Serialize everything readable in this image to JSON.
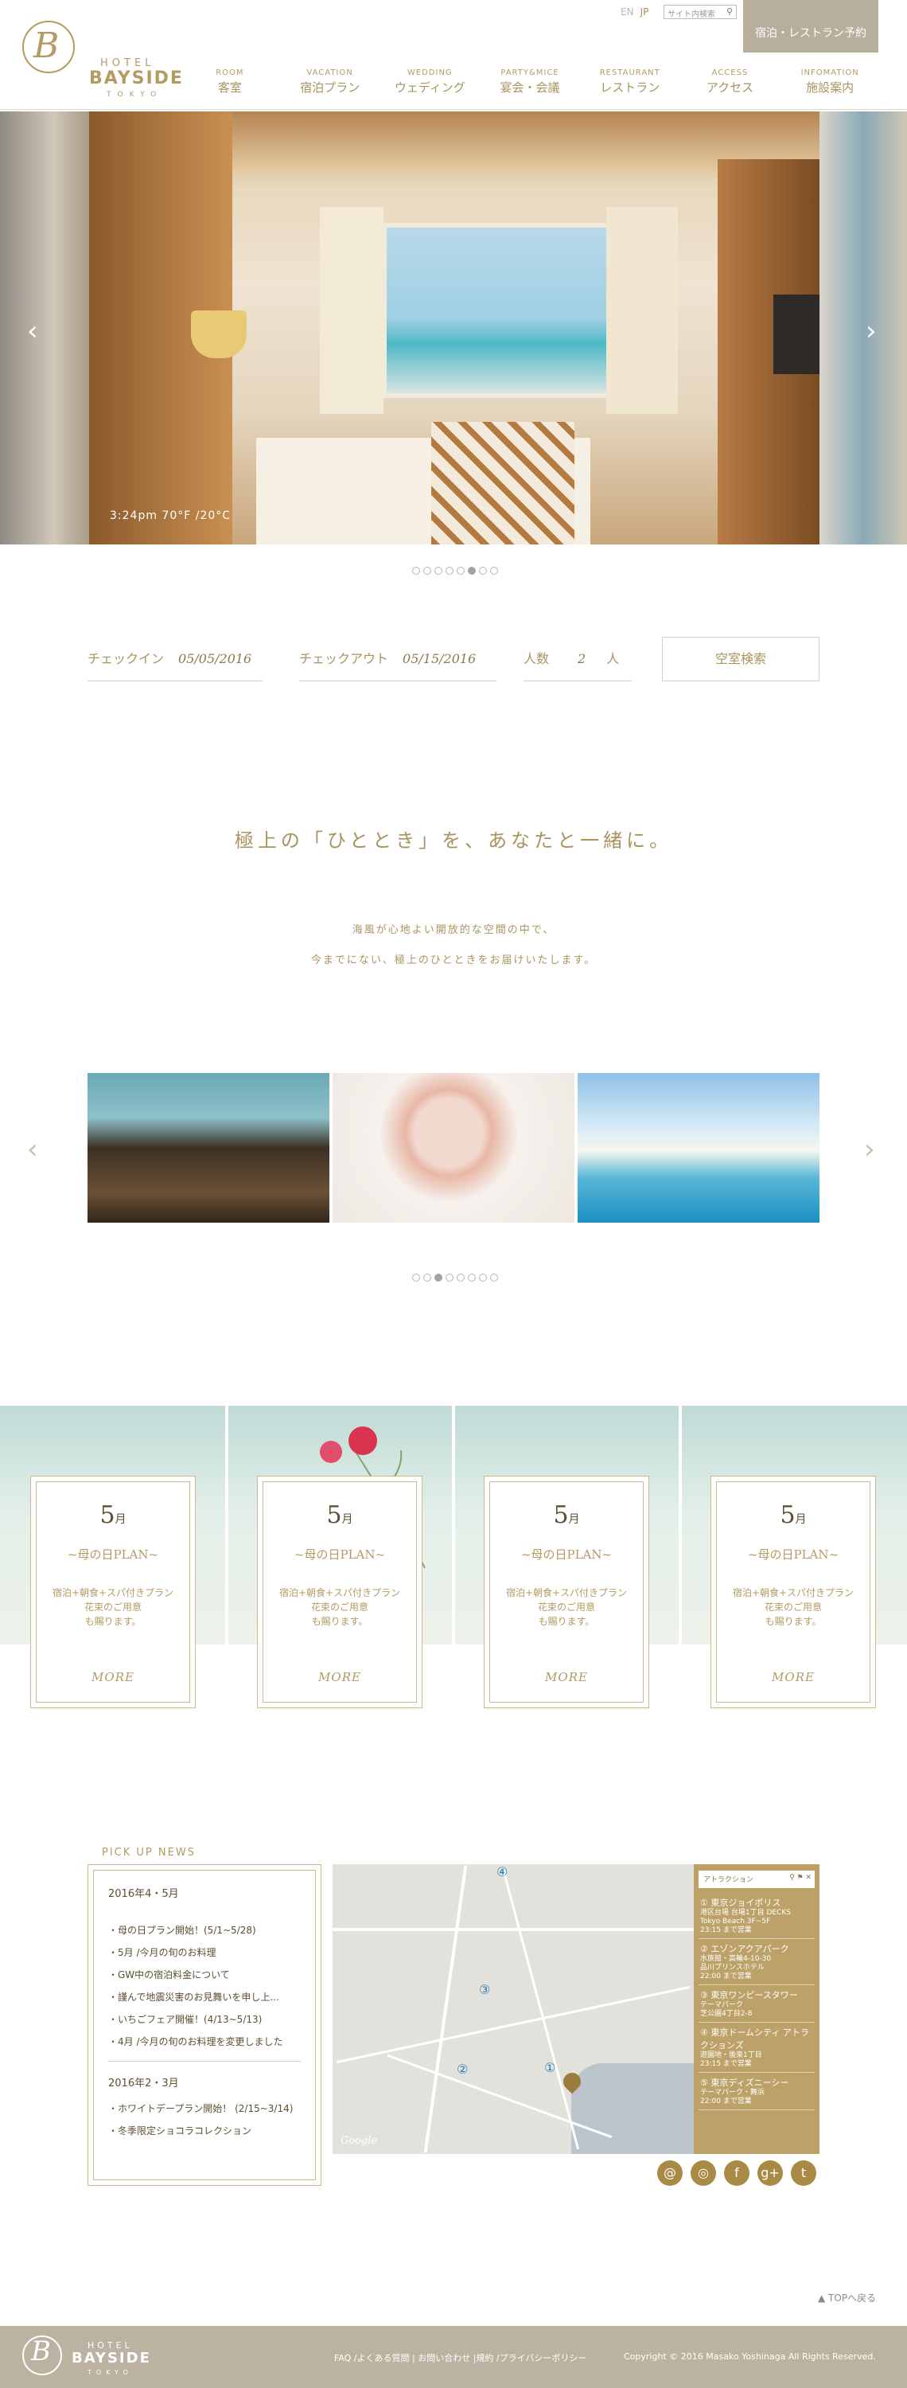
{
  "header": {
    "logo": {
      "mark": "B",
      "hotel": "HOTEL",
      "name": "BAYSIDE",
      "city": "TOKYO"
    },
    "lang": [
      "EN",
      "JP"
    ],
    "search_placeholder": "サイト内検索",
    "reserve_button": "宿泊・レストラン予約",
    "nav": [
      {
        "en": "ROOM",
        "jp": "客室"
      },
      {
        "en": "VACATION",
        "jp": "宿泊プラン"
      },
      {
        "en": "WEDDING",
        "jp": "ウェディング"
      },
      {
        "en": "PARTY&MICE",
        "jp": "宴会・会議"
      },
      {
        "en": "RESTAURANT",
        "jp": "レストラン"
      },
      {
        "en": "ACCESS",
        "jp": "アクセス"
      },
      {
        "en": "INFOMATION",
        "jp": "施設案内"
      }
    ]
  },
  "hero": {
    "weather": "3:24pm  70°F /20°C",
    "active_dot": 6,
    "dot_count": 8
  },
  "search_bar": {
    "checkin_label": "チェックイン",
    "checkin_value": "05/05/2016",
    "checkout_label": "チェックアウト",
    "checkout_value": "05/15/2016",
    "guests_label": "人数",
    "guests_value": "2",
    "guests_unit": "人",
    "search_button": "空室検索"
  },
  "intro": {
    "title": "極上の「ひととき」を、あなたと一緒に。",
    "line1": "海風が心地よい開放的な空間の中で、",
    "line2": "今までにない、極上のひとときをお届けいたします。"
  },
  "gallery": {
    "active_dot": 3,
    "dot_count": 8
  },
  "plans": [
    {
      "month": "5",
      "month_unit": "月",
      "name": "~母の日PLAN~",
      "desc1": "宿泊+朝食+スパ付きプラン",
      "desc2": "花束のご用意",
      "desc3": "も賜ります。",
      "more": "MORE"
    },
    {
      "month": "5",
      "month_unit": "月",
      "name": "~母の日PLAN~",
      "desc1": "宿泊+朝食+スパ付きプラン",
      "desc2": "花束のご用意",
      "desc3": "も賜ります。",
      "more": "MORE"
    },
    {
      "month": "5",
      "month_unit": "月",
      "name": "~母の日PLAN~",
      "desc1": "宿泊+朝食+スパ付きプラン",
      "desc2": "花束のご用意",
      "desc3": "も賜ります。",
      "more": "MORE"
    },
    {
      "month": "5",
      "month_unit": "月",
      "name": "~母の日PLAN~",
      "desc1": "宿泊+朝食+スパ付きプラン",
      "desc2": "花束のご用意",
      "desc3": "も賜ります。",
      "more": "MORE"
    }
  ],
  "news": {
    "heading": "PICK UP NEWS",
    "period1": "2016年4・5月",
    "items1": [
      "・母の日プラン開始！(5/1~5/28)",
      "・5月 /今月の旬のお料理",
      "・GW中の宿泊料金について",
      "・謹んで地震災害のお見舞いを申し上...",
      "・いちごフェア開催！(4/13~5/13)",
      "・4月 /今月の旬のお料理を変更しました"
    ],
    "period2": "2016年2・3月",
    "items2": [
      "・ホワイトデープラン開始！ (2/15~3/14)",
      "・冬季限定ショコラコレクション"
    ]
  },
  "map": {
    "google": "Google",
    "markers": [
      "①",
      "②",
      "③",
      "④"
    ],
    "search_label": "アトラクション",
    "spots": [
      {
        "name": "① 東京ジョイポリス",
        "sub1": "港区台場 台場1丁目 DECKS",
        "sub2": "Tokyo Beach 3F~5F",
        "sub3": "23:15 まで営業"
      },
      {
        "name": "② エゾンアクアパーク",
        "sub1": "水族館・高輪4-10-30",
        "sub2": "品川プリンスホテル",
        "sub3": "22:00 まで営業"
      },
      {
        "name": "③ 東京ワンピースタワー",
        "sub1": "テーマパーク",
        "sub2": "芝公園4丁目2-8",
        "sub3": ""
      },
      {
        "name": "④ 東京ドームシティ アトラクションズ",
        "sub1": "遊園地・後楽1丁目",
        "sub2": "23:15 まで営業",
        "sub3": ""
      },
      {
        "name": "⑤ 東京ディズニーシー",
        "sub1": "テーマパーク・舞浜",
        "sub2": "22:00 まで営業",
        "sub3": ""
      }
    ]
  },
  "social": [
    "@",
    "◎",
    "f",
    "g+",
    "t"
  ],
  "footer": {
    "to_top": "▲ TOPへ戻る",
    "links": "FAQ /よくある質問 | お問い合わせ |規約 /プライバシーポリシー",
    "copyright": "Copyright © 2016 Masako Yoshinaga All Rights Reserved."
  },
  "colors": {
    "gold": "#a9945f",
    "reserve_bg": "#b7ae9c",
    "footer_bg": "#bcb2a1",
    "map_panel": "#bca169"
  }
}
